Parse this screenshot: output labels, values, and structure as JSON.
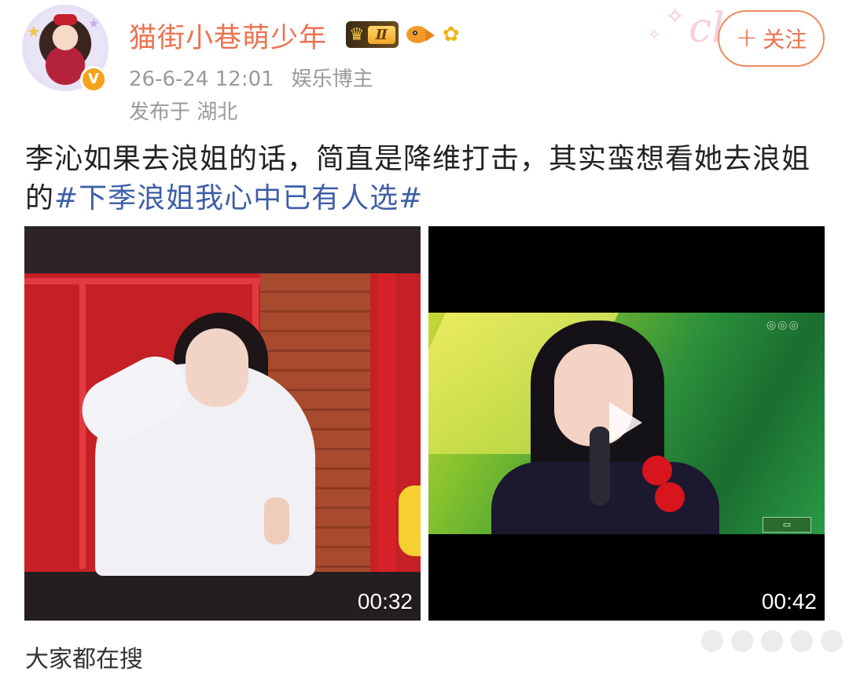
{
  "user": {
    "name": "猫街小巷萌少年",
    "verified_mark": "V",
    "level_badge": "Ⅱ",
    "time": "26-6-24 12:01",
    "role": "娱乐博主",
    "location": "发布于 湖北"
  },
  "follow": {
    "plus": "+",
    "label": "关注"
  },
  "post": {
    "text": "李沁如果去浪姐的话，简直是降维打击，其实蛮想看她去浪姐的",
    "hashtag": "#下季浪姐我心中已有人选#"
  },
  "media": [
    {
      "duration": "00:32"
    },
    {
      "duration": "00:42"
    }
  ],
  "footer": {
    "hot_search_label": "大家都在搜"
  },
  "colors": {
    "username": "#eb7350",
    "hashtag": "#3f5ea8",
    "meta": "#9a9a9a",
    "follow_border": "#f08a5d"
  },
  "icons": [
    "crown-icon",
    "fish-icon",
    "sunflower-icon",
    "play-icon",
    "verified-icon"
  ]
}
